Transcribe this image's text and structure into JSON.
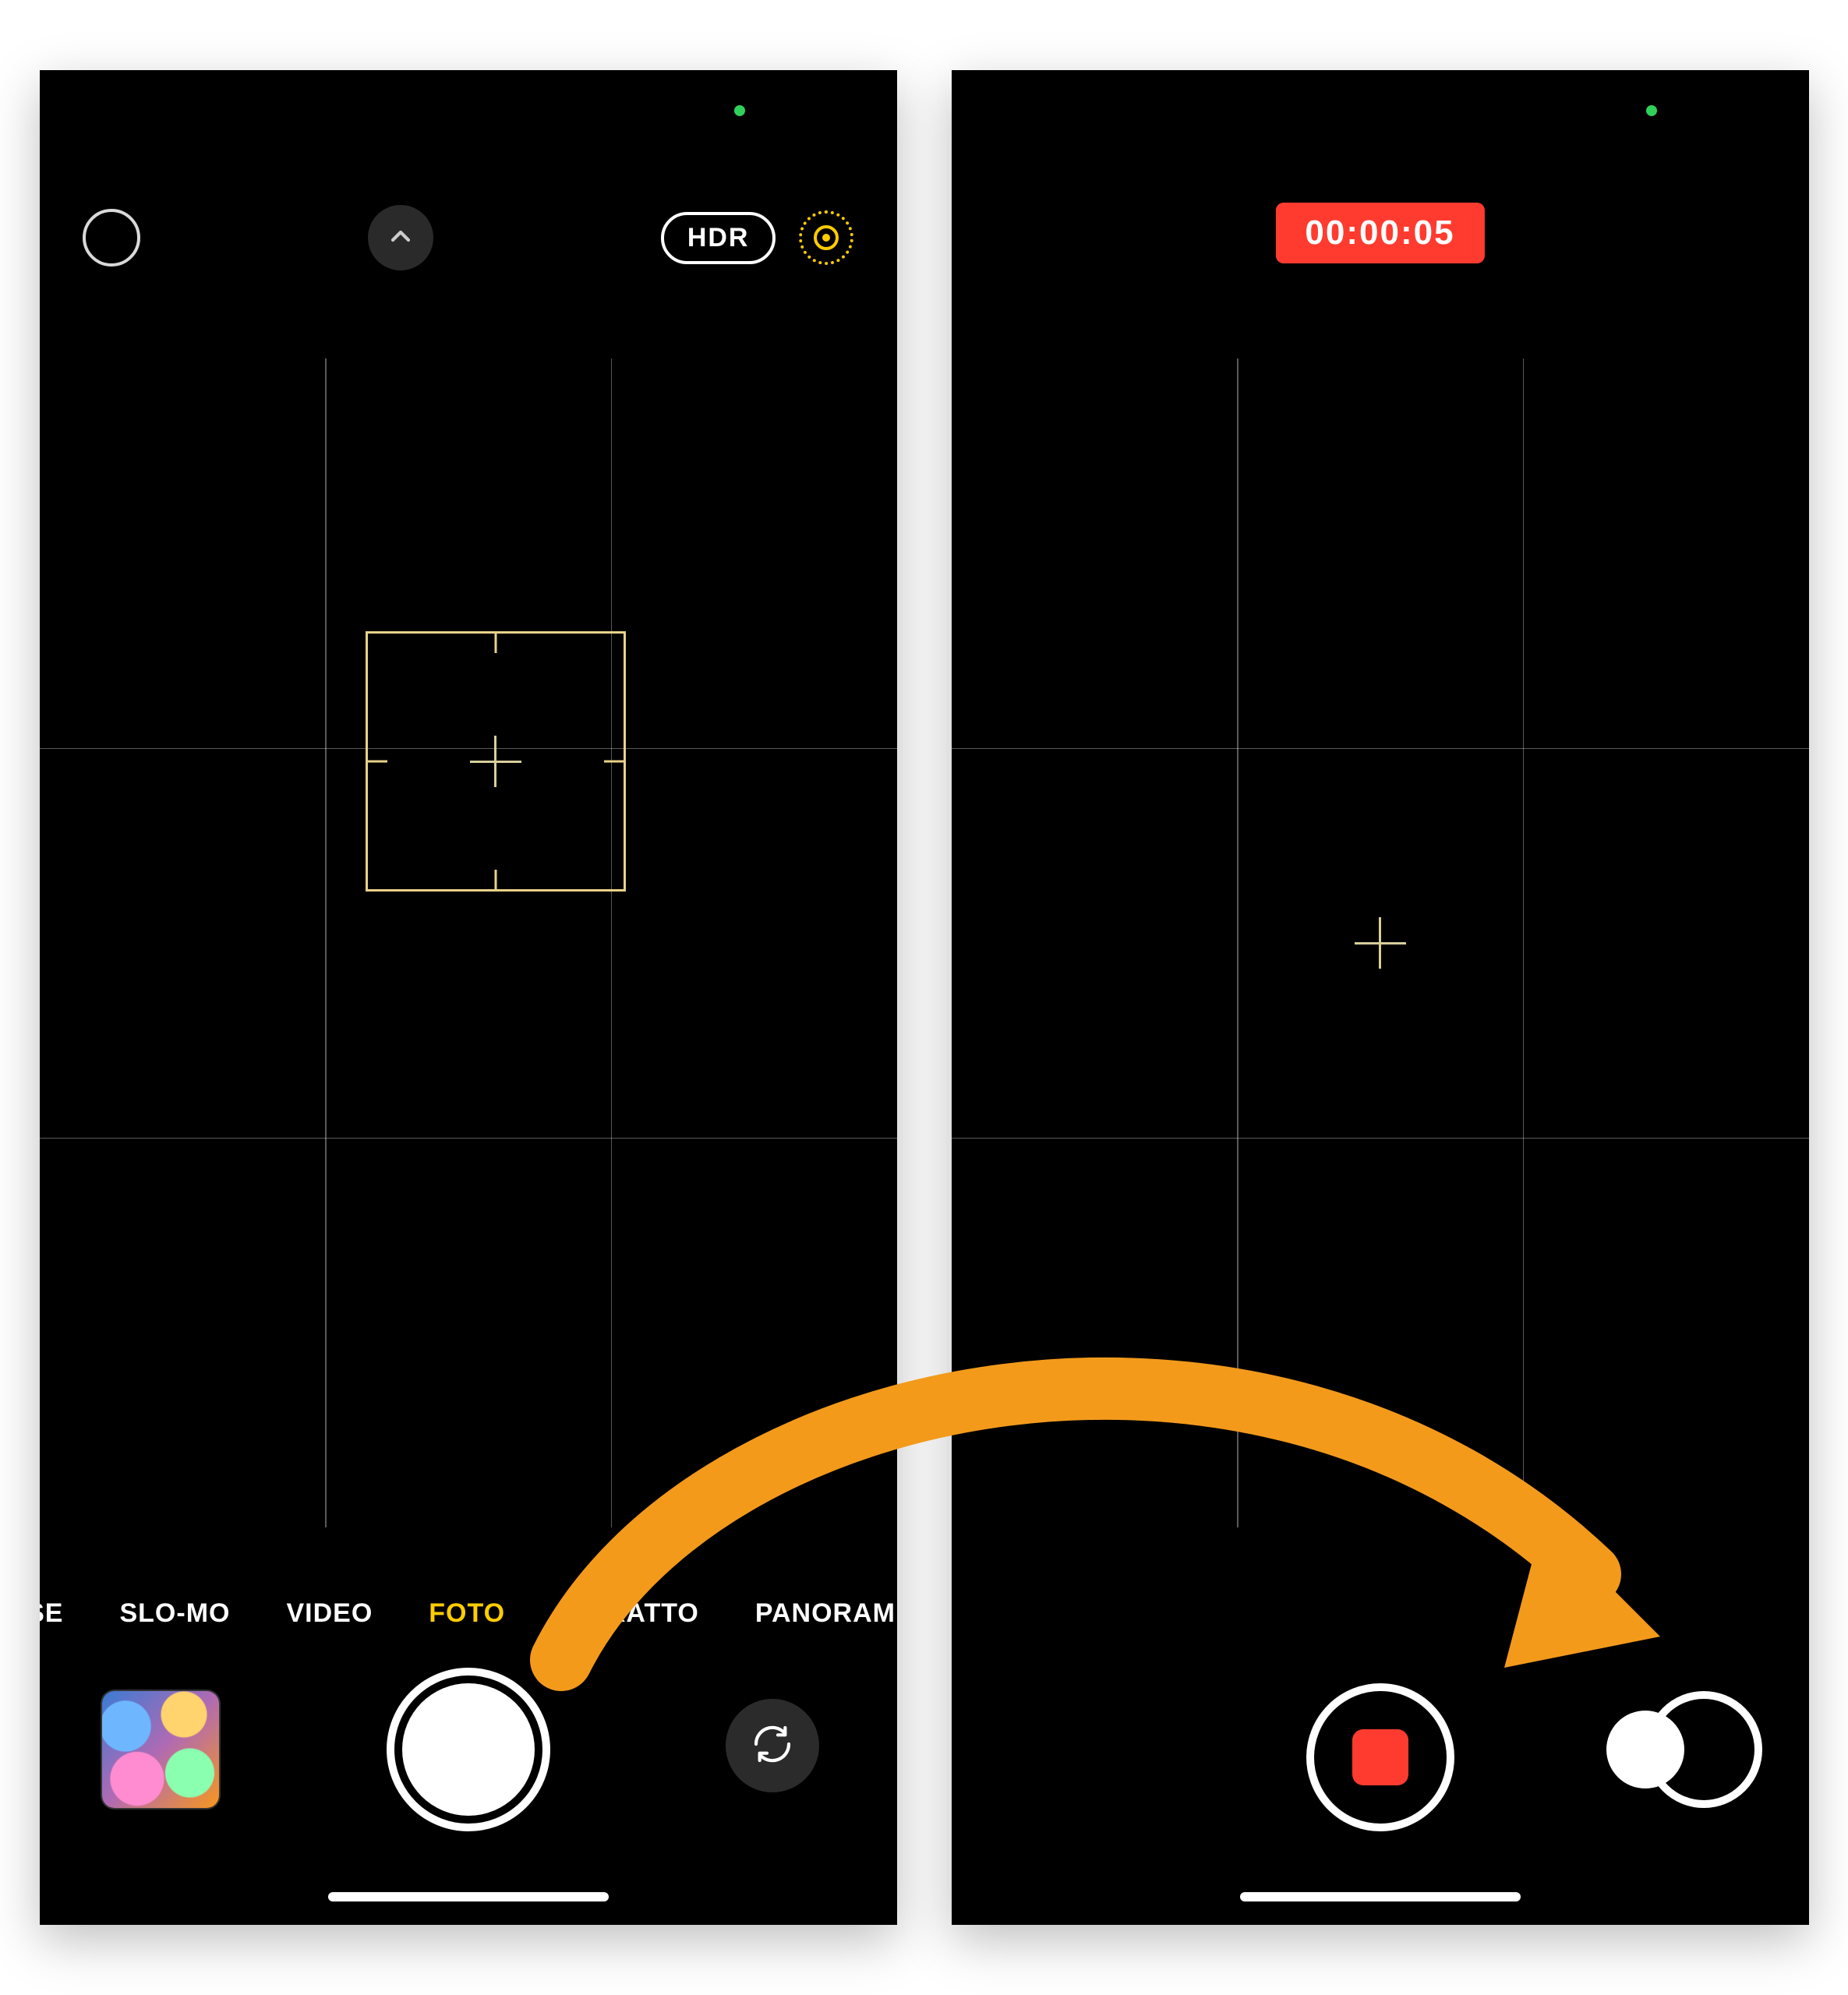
{
  "colors": {
    "accent_yellow": "#ffcc00",
    "record_red": "#ff3b30",
    "arrow_orange": "#f39a1b",
    "focus_gold": "#e9d18a",
    "camera_in_use_green": "#30d158"
  },
  "left_camera": {
    "top_bar": {
      "flash_icon": "flash-off-icon",
      "expand_icon": "chevron-up-icon",
      "hdr_label": "HDR",
      "live_photo_icon": "live-photo-icon"
    },
    "modes": {
      "items": [
        "PSE",
        "SLO-MO",
        "VIDEO",
        "FOTO",
        "RITRATTO",
        "PANORAMICA"
      ],
      "active_index": 3
    },
    "controls": {
      "thumbnail": "last-photo-thumbnail",
      "shutter": "shutter-button",
      "flip": "flip-camera-button"
    }
  },
  "right_camera": {
    "recording_timer": "00:00:05",
    "controls": {
      "stop": "stop-recording-button",
      "lock": "shutter-lock-target"
    }
  },
  "annotation": {
    "arrow": "swipe-right-to-record-arrow"
  }
}
